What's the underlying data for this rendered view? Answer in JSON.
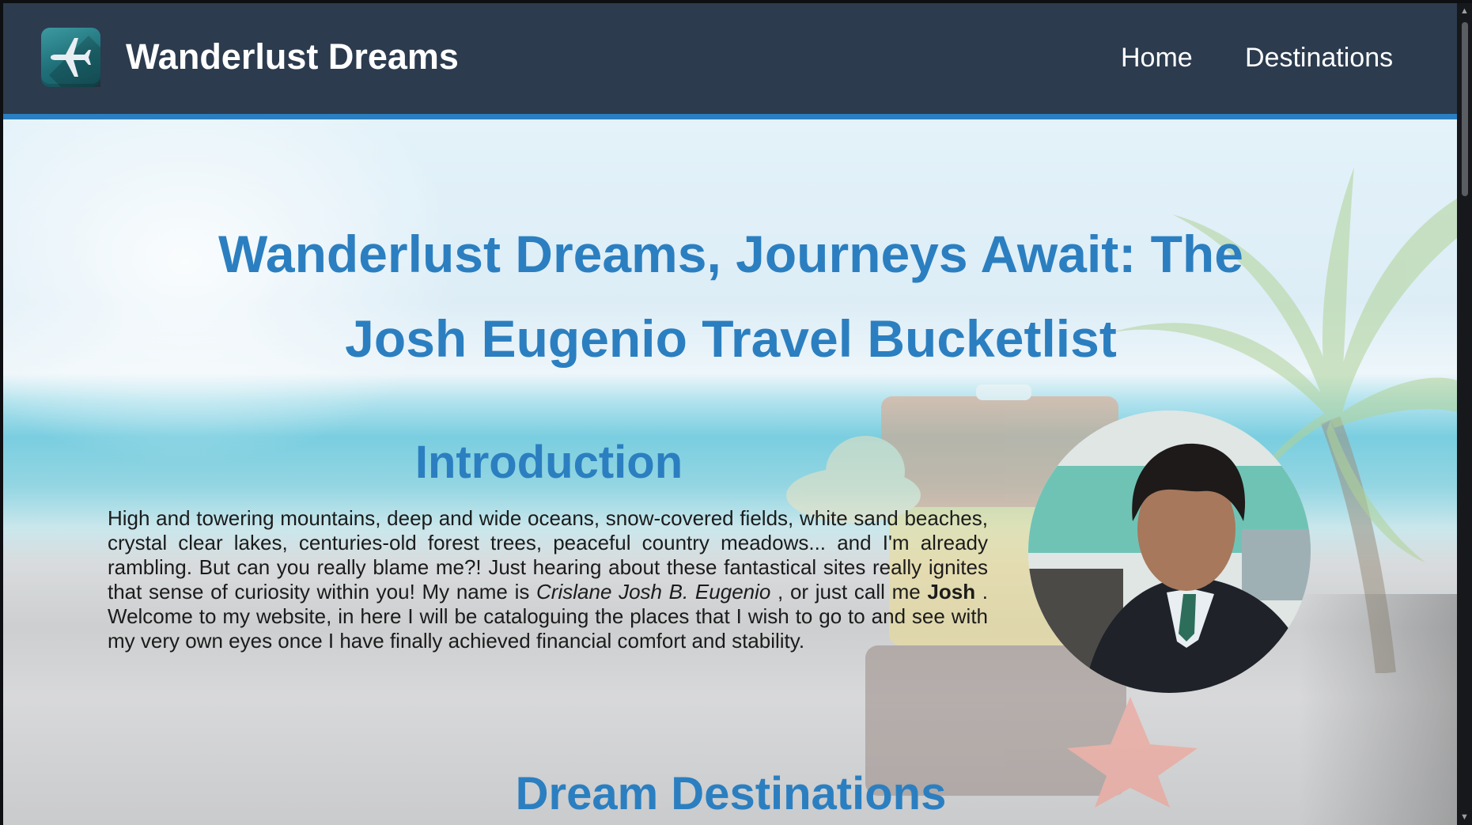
{
  "header": {
    "logo_icon": "airplane-icon",
    "brand": "Wanderlust Dreams",
    "nav": [
      {
        "label": "Home"
      },
      {
        "label": "Destinations"
      }
    ]
  },
  "hero": {
    "title": "Wanderlust Dreams, Journeys Await: The Josh Eugenio Travel Bucketlist",
    "intro_heading": "Introduction",
    "intro_part1": "High and towering mountains, deep and wide oceans, snow-covered fields, white sand beaches, crystal clear lakes, centuries-old forest trees, peaceful country meadows... and I'm already rambling. But can you really blame me?! Just hearing about these fantastical sites really ignites that sense of curiosity within you! My name is ",
    "intro_name_italic": "Crislane Josh B. Eugenio",
    "intro_part2": " , or just call me ",
    "intro_name_bold": "Josh",
    "intro_part3": " . Welcome to my website, in here I will be cataloguing the places that I wish to go to and see with my very own eyes once I have finally achieved financial comfort and stability.",
    "dest_heading": "Dream Destinations"
  },
  "colors": {
    "navbar_bg": "#2c3b4e",
    "accent": "#2b7fc0",
    "nav_text": "#ffffff"
  }
}
